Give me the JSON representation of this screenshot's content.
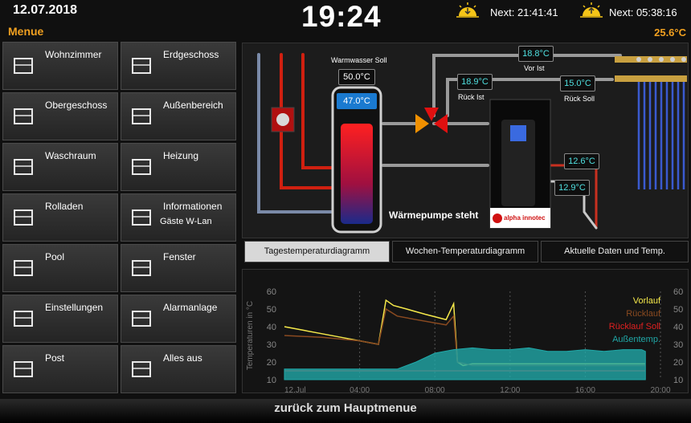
{
  "header": {
    "date": "12.07.2018",
    "menu_title": "Menue",
    "clock": "19:24",
    "sunset_next": "Next: 21:41:41",
    "sunrise_next": "Next: 05:38:16",
    "outside_temp": "25.6°C"
  },
  "menu": [
    {
      "label": "Wohnzimmer",
      "icon": "tv-icon"
    },
    {
      "label": "Erdgeschoss",
      "icon": "house-icon"
    },
    {
      "label": "Obergeschoss",
      "icon": "house-upper-icon"
    },
    {
      "label": "Außenbereich",
      "icon": "garden-icon"
    },
    {
      "label": "Waschraum",
      "icon": "washing-machine-icon"
    },
    {
      "label": "Heizung",
      "icon": "heater-icon"
    },
    {
      "label": "Rolladen",
      "icon": "shutter-icon"
    },
    {
      "label": "Informationen",
      "sub": "Gäste W-Lan",
      "icon": "wifi-icon"
    },
    {
      "label": "Pool",
      "icon": "pool-icon"
    },
    {
      "label": "Fenster",
      "icon": "window-icon"
    },
    {
      "label": "Einstellungen",
      "icon": "settings-icon"
    },
    {
      "label": "Alarmanlage",
      "icon": "lock-icon"
    },
    {
      "label": "Post",
      "icon": "mail-icon"
    },
    {
      "label": "Alles aus",
      "icon": "sleep-icon"
    }
  ],
  "panel": {
    "warmwasser_label": "Warmwasser Soll",
    "warmwasser_soll": "50.0°C",
    "warmwasser_ist": "47.0°C",
    "vor_ist_value": "18.8°C",
    "vor_ist_label": "Vor Ist",
    "rueck_ist_value": "18.9°C",
    "rueck_ist_label": "Rück Ist",
    "rueck_soll_value": "15.0°C",
    "rueck_soll_label": "Rück Soll",
    "t1": "12.6°C",
    "t2": "12.9°C",
    "status": "Wärmepumpe steht",
    "brand": "alpha innotec"
  },
  "tabs": [
    {
      "label": "Tagestemperaturdiagramm",
      "active": true
    },
    {
      "label": "Wochen-Temperaturdiagramm",
      "active": false
    },
    {
      "label": "Aktuelle Daten und Temp.",
      "active": false
    }
  ],
  "chart_data": {
    "type": "line",
    "ylabel": "Temperaturen in °C",
    "yticks": [
      10,
      20,
      30,
      40,
      50,
      60
    ],
    "xticks": [
      "12.Jul",
      "04:00",
      "08:00",
      "12:00",
      "16:00",
      "20:00"
    ],
    "ylim": [
      10,
      60
    ],
    "xlim": [
      0,
      20
    ],
    "legend_position": "top-right",
    "series": [
      {
        "name": "Vorlauf",
        "color": "#f5e94a",
        "x": [
          0,
          1,
          2,
          3,
          4,
          5,
          5.4,
          5.8,
          6.5,
          7.5,
          8.6,
          9.0,
          9.2,
          9.5,
          10,
          12,
          16,
          19.2
        ],
        "y": [
          40,
          38,
          36,
          34,
          32,
          30,
          55,
          52,
          50,
          47,
          44,
          53,
          20,
          18,
          19,
          19,
          19,
          19
        ]
      },
      {
        "name": "Rücklauf",
        "color": "#8a4a20",
        "x": [
          0,
          2,
          4,
          5,
          5.4,
          6,
          7,
          8.6,
          9.0,
          9.2,
          10,
          14,
          19.2
        ],
        "y": [
          35,
          34,
          32,
          30,
          50,
          46,
          44,
          41,
          46,
          20,
          18,
          18,
          18
        ]
      },
      {
        "name": "Rücklauf Soll",
        "color": "#e02020",
        "x": [
          0,
          19.2
        ],
        "y": [
          15,
          15
        ]
      },
      {
        "name": "Außentemp.",
        "color": "#20a8a8",
        "x": [
          0,
          2,
          4,
          6,
          7,
          8,
          9,
          10,
          11,
          12,
          13,
          14,
          15,
          16,
          17,
          18,
          19,
          19.2
        ],
        "y": [
          16,
          16,
          16,
          16,
          20,
          25,
          27,
          28,
          27,
          27,
          28,
          26,
          26,
          27,
          26,
          27,
          27,
          26
        ]
      }
    ]
  },
  "footer": {
    "back_label": "zurück zum Hauptmenue"
  },
  "colors": {
    "accent": "#f0a020",
    "value": "#4fe0e0"
  }
}
